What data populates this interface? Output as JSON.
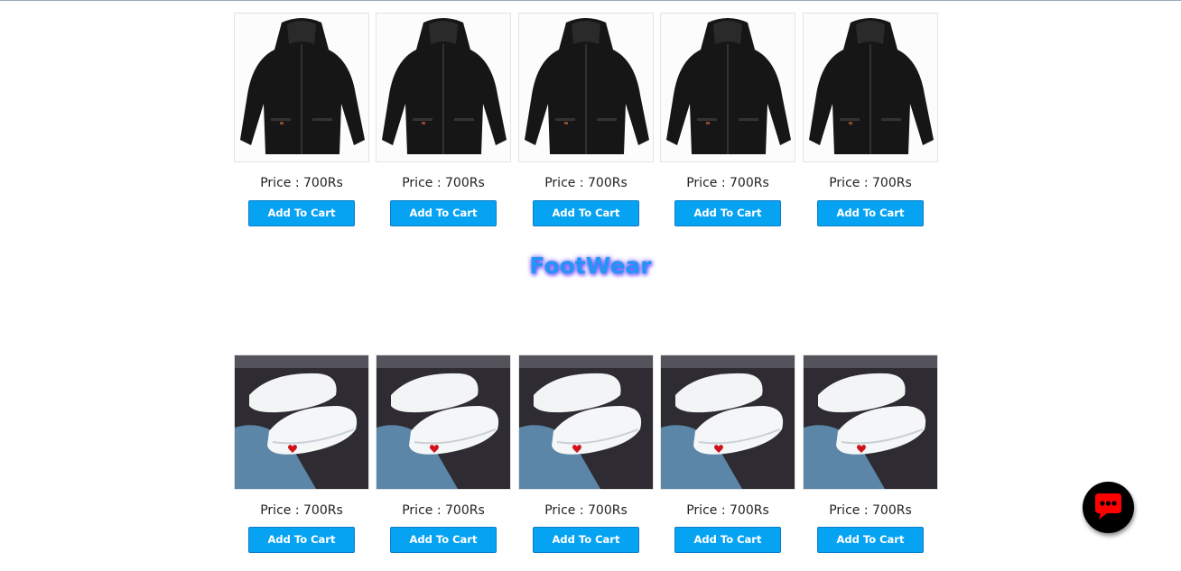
{
  "jackets": {
    "products": [
      {
        "image": "black-jacket",
        "price": "Price : 700Rs",
        "button": "Add To Cart"
      },
      {
        "image": "black-jacket",
        "price": "Price : 700Rs",
        "button": "Add To Cart"
      },
      {
        "image": "black-jacket",
        "price": "Price : 700Rs",
        "button": "Add To Cart"
      },
      {
        "image": "black-jacket",
        "price": "Price : 700Rs",
        "button": "Add To Cart"
      },
      {
        "image": "black-jacket",
        "price": "Price : 700Rs",
        "button": "Add To Cart"
      }
    ]
  },
  "footwear": {
    "title": "FootWear",
    "products": [
      {
        "image": "white-sneakers",
        "price": "Price : 700Rs",
        "button": "Add To Cart"
      },
      {
        "image": "white-sneakers",
        "price": "Price : 700Rs",
        "button": "Add To Cart"
      },
      {
        "image": "white-sneakers",
        "price": "Price : 700Rs",
        "button": "Add To Cart"
      },
      {
        "image": "white-sneakers",
        "price": "Price : 700Rs",
        "button": "Add To Cart"
      },
      {
        "image": "white-sneakers",
        "price": "Price : 700Rs",
        "button": "Add To Cart"
      }
    ]
  },
  "chat": {
    "icon": "chat-bubble-icon"
  },
  "colors": {
    "button_bg": "#07a3f3",
    "title": "#2196f3",
    "title_glow": "#6a4cff",
    "chat_bg": "#000000",
    "chat_icon": "#ff0000"
  }
}
